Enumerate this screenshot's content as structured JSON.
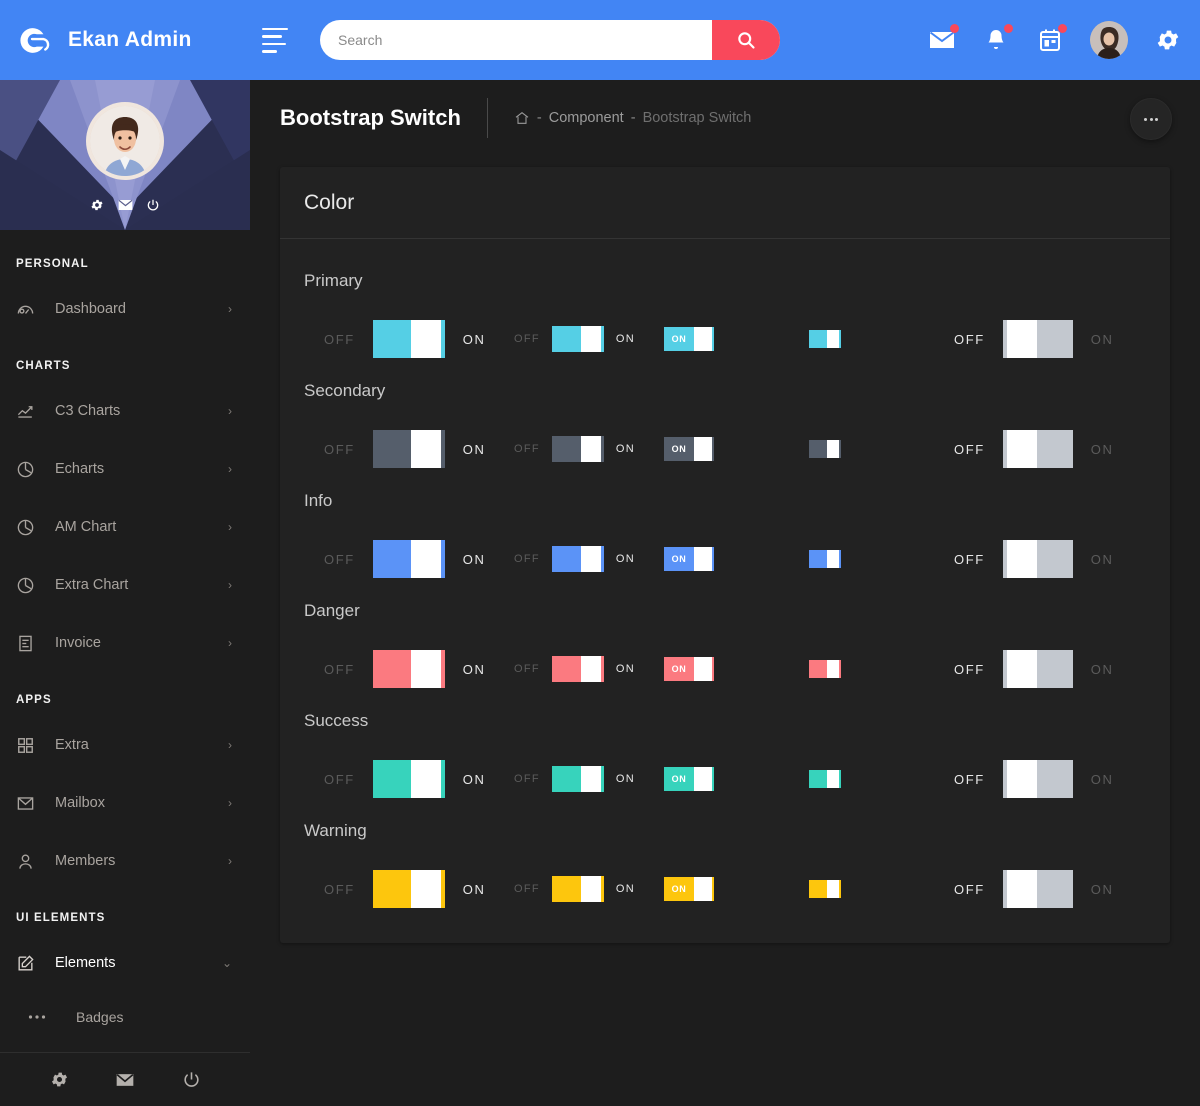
{
  "brand": {
    "name": "Ekan Admin",
    "logo_icon": "ekan-logo-icon"
  },
  "topbar": {
    "menu_toggle_icon": "hamburger-icon",
    "search": {
      "placeholder": "Search",
      "value": "",
      "button_icon": "search-icon"
    },
    "icons": [
      {
        "name": "mail-icon",
        "badge": true
      },
      {
        "name": "bell-icon",
        "badge": true
      },
      {
        "name": "calendar-icon",
        "badge": true
      }
    ],
    "avatar": "user-avatar",
    "settings_icon": "gear-icon",
    "accent_color": "#4285f4",
    "search_button_color": "#f9485b"
  },
  "sidebar": {
    "profile": {
      "avatar": "profile-avatar",
      "actions": [
        {
          "name": "profile-settings-icon"
        },
        {
          "name": "profile-mail-icon"
        },
        {
          "name": "profile-logout-icon"
        }
      ]
    },
    "sections": [
      {
        "heading": "PERSONAL",
        "items": [
          {
            "label": "Dashboard",
            "icon": "dashboard-icon",
            "arrow": "chevron-right-icon",
            "active": false
          }
        ]
      },
      {
        "heading": "CHARTS",
        "items": [
          {
            "label": "C3 Charts",
            "icon": "line-chart-icon",
            "arrow": "chevron-right-icon",
            "active": false
          },
          {
            "label": "Echarts",
            "icon": "pie-chart-icon",
            "arrow": "chevron-right-icon",
            "active": false
          },
          {
            "label": "AM Chart",
            "icon": "pie-chart-icon",
            "arrow": "chevron-right-icon",
            "active": false
          },
          {
            "label": "Extra Chart",
            "icon": "pie-chart-icon",
            "arrow": "chevron-right-icon",
            "active": false
          },
          {
            "label": "Invoice",
            "icon": "invoice-icon",
            "arrow": "chevron-right-icon",
            "active": false
          }
        ]
      },
      {
        "heading": "APPS",
        "items": [
          {
            "label": "Extra",
            "icon": "grid-icon",
            "arrow": "chevron-right-icon",
            "active": false
          },
          {
            "label": "Mailbox",
            "icon": "envelope-icon",
            "arrow": "chevron-right-icon",
            "active": false
          },
          {
            "label": "Members",
            "icon": "user-icon",
            "arrow": "chevron-right-icon",
            "active": false
          }
        ]
      },
      {
        "heading": "UI ELEMENTS",
        "items": [
          {
            "label": "Elements",
            "icon": "edit-icon",
            "arrow": "chevron-down-icon",
            "active": true
          },
          {
            "label": "Badges",
            "icon": "dots-icon",
            "arrow": "",
            "active": false,
            "sub": true
          }
        ]
      }
    ],
    "footer": [
      {
        "name": "footer-gear-icon"
      },
      {
        "name": "footer-mail-icon"
      },
      {
        "name": "footer-power-icon"
      }
    ]
  },
  "page": {
    "title": "Bootstrap Switch",
    "breadcrumb": {
      "home_icon": "home-icon",
      "items": [
        {
          "sep": "-",
          "label": "Component",
          "current": false
        },
        {
          "sep": "-",
          "label": "Bootstrap Switch",
          "current": true
        }
      ]
    },
    "more_button": "more-options-button"
  },
  "card": {
    "title": "Color",
    "labels": {
      "off": "OFF",
      "on": "ON"
    },
    "rows": [
      {
        "name": "Primary",
        "color": "#55cfe5"
      },
      {
        "name": "Secondary",
        "color": "#555e6b"
      },
      {
        "name": "Info",
        "color": "#5b93f7"
      },
      {
        "name": "Danger",
        "color": "#fb7a80"
      },
      {
        "name": "Success",
        "color": "#37d3bc"
      },
      {
        "name": "Warning",
        "color": "#fdc60d"
      }
    ],
    "off_track_color": "#c3c8cf",
    "switches": [
      {
        "variant": "lg",
        "state": "on",
        "left_label": "OFF",
        "right_label": "ON",
        "inner_label": "",
        "left_style": "dim",
        "right_style": "bright"
      },
      {
        "variant": "md",
        "state": "on",
        "left_label": "OFF",
        "right_label": "ON",
        "inner_label": "",
        "left_style": "dim",
        "right_style": "bright"
      },
      {
        "variant": "sm",
        "state": "on",
        "left_label": "",
        "right_label": "",
        "inner_label": "ON",
        "left_style": "",
        "right_style": ""
      },
      {
        "variant": "mini",
        "state": "on",
        "left_label": "",
        "right_label": "",
        "inner_label": "",
        "left_style": "",
        "right_style": ""
      },
      {
        "variant": "off",
        "state": "off",
        "left_label": "OFF",
        "right_label": "ON",
        "inner_label": "",
        "left_style": "bright",
        "right_style": "dim"
      }
    ]
  }
}
